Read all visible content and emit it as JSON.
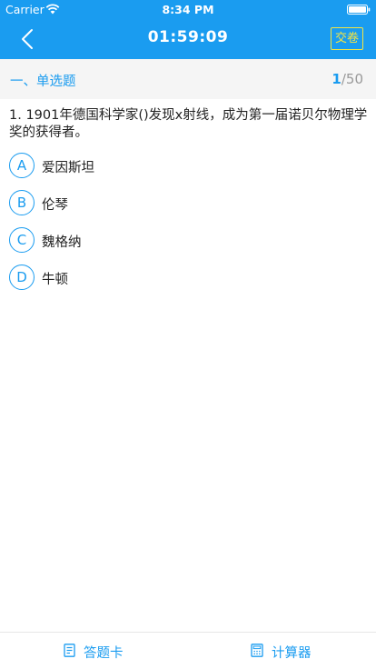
{
  "status": {
    "carrier": "Carrier",
    "time": "8:34 PM"
  },
  "nav": {
    "timer": "01:59:09",
    "submit_label": "交卷"
  },
  "section": {
    "title": "一、单选题",
    "current": "1",
    "total": "/50"
  },
  "question": {
    "text": "1. 1901年德国科学家()发现x射线，成为第一届诺贝尔物理学奖的获得者。"
  },
  "options": [
    {
      "letter": "A",
      "text": "爱因斯坦"
    },
    {
      "letter": "B",
      "text": "伦琴"
    },
    {
      "letter": "C",
      "text": "魏格纳"
    },
    {
      "letter": "D",
      "text": "牛顿"
    }
  ],
  "tabs": {
    "answer_card": "答题卡",
    "calculator": "计算器"
  },
  "colors": {
    "accent": "#1a9cf0",
    "submit_border": "#f4e542"
  }
}
